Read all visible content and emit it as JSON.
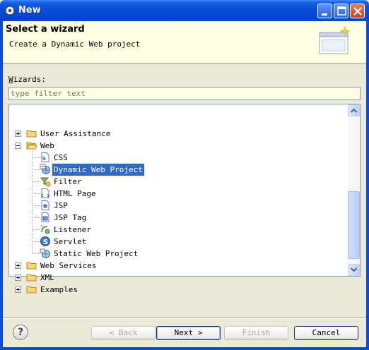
{
  "window": {
    "title": "New",
    "icon": "eclipse-gear-icon"
  },
  "banner": {
    "title": "Select a wizard",
    "description": "Create a Dynamic Web project",
    "image": "wizard-banner-icon"
  },
  "wizards_label": {
    "accel": "W",
    "rest": "izards:"
  },
  "filter": {
    "placeholder": "type filter text",
    "value": ""
  },
  "tree": {
    "items": [
      {
        "label": "User Assistance",
        "icon": "folder-icon",
        "expander": "plus",
        "level": 0
      },
      {
        "label": "Web",
        "icon": "folder-open-icon",
        "expander": "minus",
        "level": 0
      },
      {
        "label": "CSS",
        "icon": "css-file-icon",
        "level": 1
      },
      {
        "label": "Dynamic Web Project",
        "icon": "dynamic-web-project-icon",
        "level": 1,
        "selected": true
      },
      {
        "label": "Filter",
        "icon": "filter-icon",
        "level": 1
      },
      {
        "label": "HTML Page",
        "icon": "html-page-icon",
        "level": 1
      },
      {
        "label": "JSP",
        "icon": "jsp-icon",
        "level": 1
      },
      {
        "label": "JSP Tag",
        "icon": "jsp-tag-icon",
        "level": 1
      },
      {
        "label": "Listener",
        "icon": "listener-icon",
        "level": 1
      },
      {
        "label": "Servlet",
        "icon": "servlet-icon",
        "level": 1
      },
      {
        "label": "Static Web Project",
        "icon": "static-web-project-icon",
        "level": 1
      },
      {
        "label": "Web Services",
        "icon": "folder-icon",
        "expander": "plus",
        "level": 0
      },
      {
        "label": "XML",
        "icon": "folder-icon",
        "expander": "plus",
        "level": 0
      },
      {
        "label": "Examples",
        "icon": "folder-icon",
        "expander": "plus",
        "level": 0
      }
    ],
    "scroll_position": 0.95
  },
  "buttons": {
    "back": "< Back",
    "next": "Next >",
    "finish": "Finish",
    "cancel": "Cancel",
    "help_icon": "help-icon"
  },
  "colors": {
    "selection": "#316ac5",
    "banner_bg": "#ffffe1",
    "title_bar": "#0a4fd9"
  }
}
